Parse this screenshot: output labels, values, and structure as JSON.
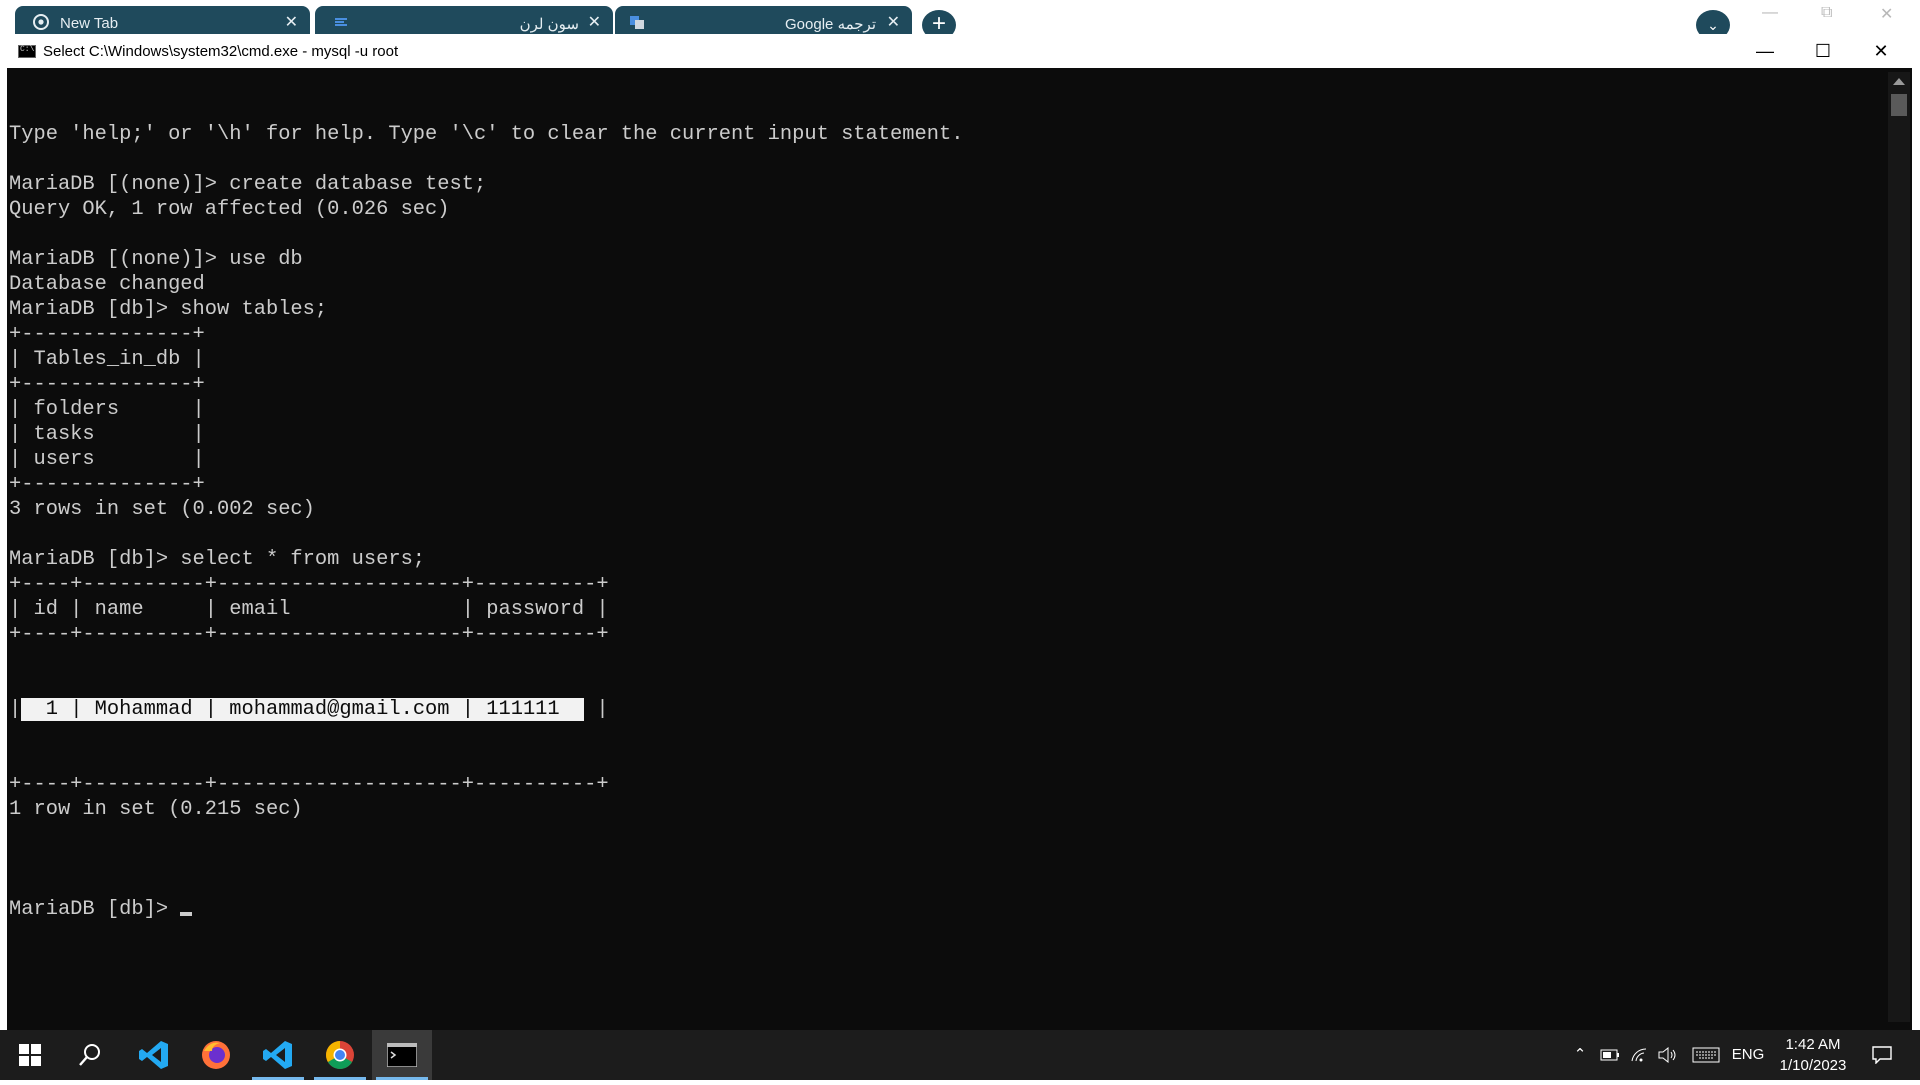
{
  "browser": {
    "tabs": [
      {
        "label": "New Tab",
        "icon": "chrome-icon"
      },
      {
        "label": "سون لرن",
        "icon": "site-icon"
      },
      {
        "label": "Google ترجمه",
        "icon": "translate-icon"
      }
    ],
    "new_tab_label": "+",
    "close_glyph": "✕"
  },
  "cmd": {
    "title": "Select C:\\Windows\\system32\\cmd.exe - mysql  -u root",
    "lines": [
      "Type 'help;' or '\\h' for help. Type '\\c' to clear the current input statement.",
      "",
      "MariaDB [(none)]> create database test;",
      "Query OK, 1 row affected (0.026 sec)",
      "",
      "MariaDB [(none)]> use db",
      "Database changed",
      "MariaDB [db]> show tables;",
      "+--------------+",
      "| Tables_in_db |",
      "+--------------+",
      "| folders      |",
      "| tasks        |",
      "| users        |",
      "+--------------+",
      "3 rows in set (0.002 sec)",
      "",
      "MariaDB [db]> select * from users;",
      "+----+----------+--------------------+----------+",
      "| id | name     | email              | password |",
      "+----+----------+--------------------+----------+"
    ],
    "row_prefix": "|",
    "row_highlight": "  1 | Mohammad | mohammad@gmail.com | 111111  ",
    "row_suffix": " |",
    "lines_after": [
      "+----+----------+--------------------+----------+",
      "1 row in set (0.215 sec)",
      ""
    ],
    "prompt": "MariaDB [db]> "
  },
  "taskbar": {
    "apps": [
      {
        "name": "start-button",
        "icon": "windows-icon"
      },
      {
        "name": "search-button",
        "icon": "search-icon"
      },
      {
        "name": "vscode",
        "icon": "vscode-icon"
      },
      {
        "name": "firefox",
        "icon": "firefox-icon"
      },
      {
        "name": "vscode-2",
        "icon": "vscode-icon"
      },
      {
        "name": "chrome",
        "icon": "chrome-icon"
      },
      {
        "name": "cmd",
        "icon": "terminal-icon"
      }
    ],
    "language": "ENG",
    "time": "1:42 AM",
    "date": "1/10/2023"
  },
  "colors": {
    "terminal_bg": "#0c0c0c",
    "terminal_fg": "#cccccc",
    "tab_bg": "#1f4a5c",
    "taskbar_bg": "#1c1c1c",
    "taskbar_accent": "#76b9ed"
  }
}
